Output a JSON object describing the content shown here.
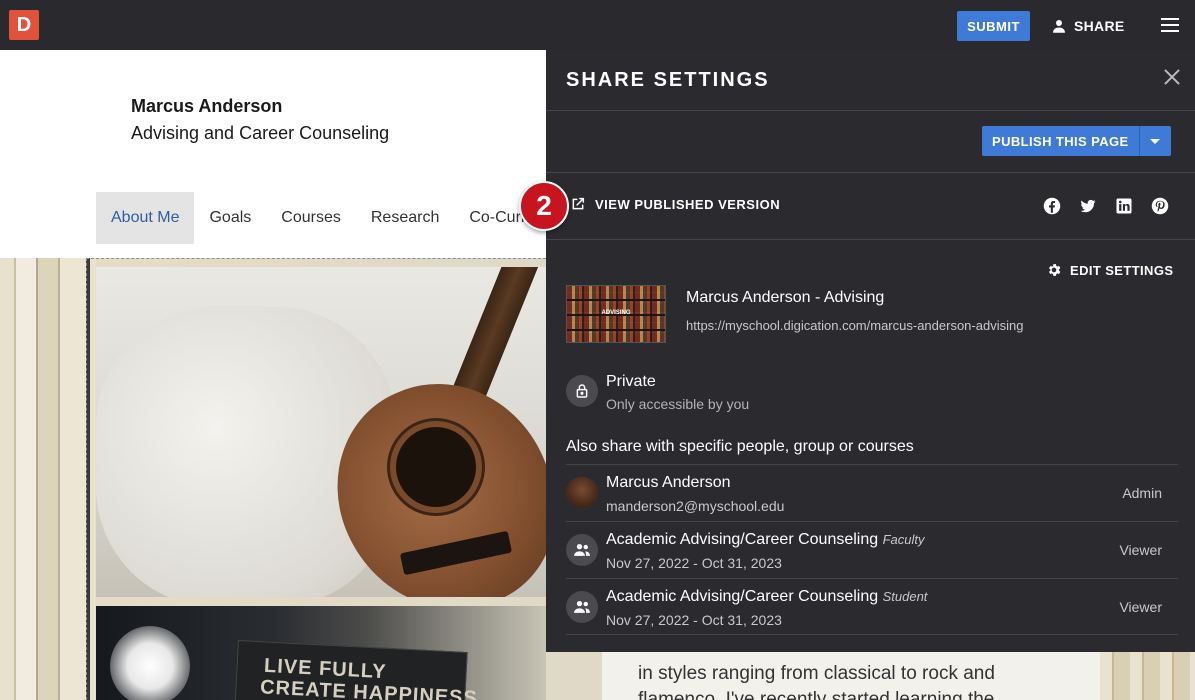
{
  "topbar": {
    "logo_letter": "D",
    "submit_label": "SUBMIT",
    "share_label": "SHARE"
  },
  "page": {
    "owner_name": "Marcus Anderson",
    "owner_subtitle": "Advising and Career Counseling",
    "nav": [
      "About Me",
      "Goals",
      "Courses",
      "Research",
      "Co-Curr"
    ],
    "active_nav": "About Me",
    "box_line1": "LIVE FULLY",
    "box_line2": "CREATE HAPPINESS",
    "body_line1": "in styles ranging from classical to rock and",
    "body_line2": "flamenco. I've recently started learning the"
  },
  "share_panel": {
    "title": "SHARE SETTINGS",
    "publish_label": "PUBLISH THIS PAGE",
    "view_published_label": "VIEW PUBLISHED VERSION",
    "social_icons": [
      "facebook-icon",
      "twitter-icon",
      "linkedin-icon",
      "pinterest-icon"
    ],
    "edit_settings_label": "EDIT SETTINGS",
    "thumbnail_label": "ADVISING",
    "page_name": "Marcus Anderson - Advising",
    "page_url": "https://myschool.digication.com/marcus-anderson-advising",
    "privacy_title": "Private",
    "privacy_subtitle": "Only accessible by you",
    "share_with_label": "Also share with specific people, group or courses",
    "members": [
      {
        "name": "Marcus Anderson",
        "tag": "",
        "sub": "manderson2@myschool.edu",
        "role": "Admin",
        "avatar": "user-photo"
      },
      {
        "name": "Academic Advising/Career Counseling",
        "tag": "Faculty",
        "sub": "Nov 27, 2022 - Oct 31, 2023",
        "role": "Viewer",
        "avatar": "group-icon"
      },
      {
        "name": "Academic Advising/Career Counseling",
        "tag": "Student",
        "sub": "Nov 27, 2022 - Oct 31, 2023",
        "role": "Viewer",
        "avatar": "group-icon"
      }
    ]
  },
  "step_badge": "2",
  "colors": {
    "topbar_bg": "#2a2a2e",
    "panel_bg": "#2b2b2f",
    "accent_blue": "#3f7ad6",
    "logo_red": "#e0533a",
    "badge_red": "#c8141e",
    "nav_active_text": "#2d5f9e"
  }
}
